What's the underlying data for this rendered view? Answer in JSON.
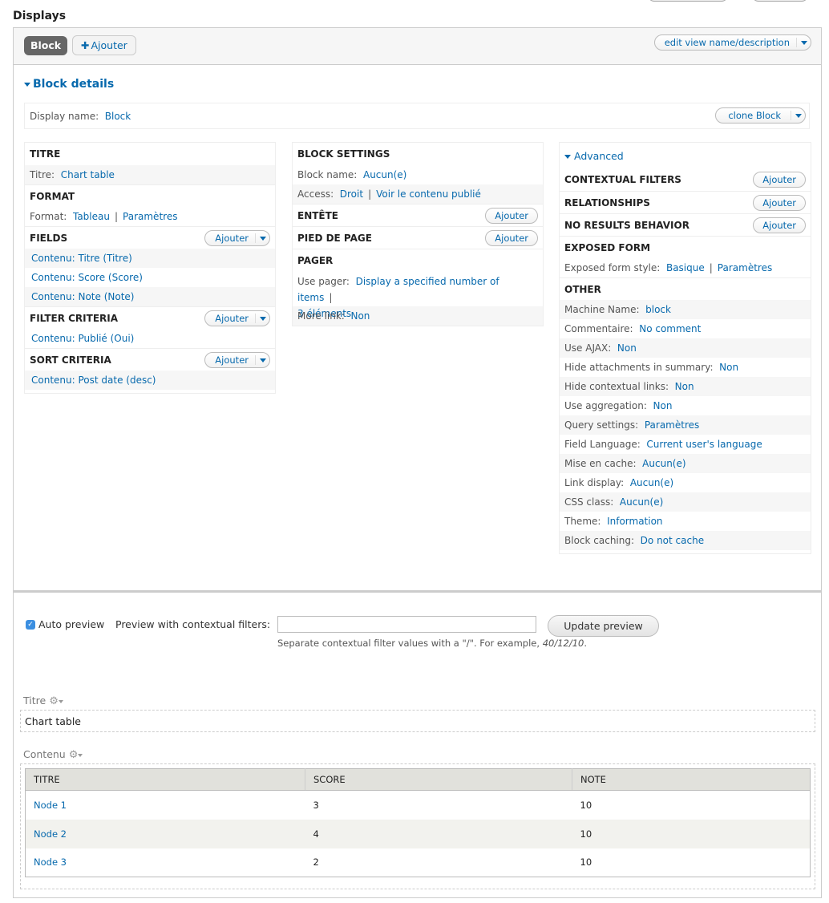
{
  "page_title": "Displays",
  "tabs": {
    "active": "Block",
    "add_label": "Ajouter",
    "add_icon": "plus-icon"
  },
  "edit_view_button": "edit view name/description",
  "block_details": {
    "toggle_label": "Block details",
    "display_name_label": "Display name:",
    "display_name_value": "Block",
    "clone_button": "clone Block"
  },
  "add_label": "Ajouter",
  "col1": {
    "titre": {
      "heading": "TITRE",
      "label": "Titre:",
      "value": "Chart table"
    },
    "format": {
      "heading": "FORMAT",
      "label": "Format:",
      "value": "Tableau",
      "settings": "Paramètres"
    },
    "fields": {
      "heading": "FIELDS",
      "items": [
        "Contenu: Titre (Titre)",
        "Contenu: Score (Score)",
        "Contenu: Note (Note)"
      ]
    },
    "filter": {
      "heading": "FILTER CRITERIA",
      "items": [
        "Contenu: Publié (Oui)"
      ]
    },
    "sort": {
      "heading": "SORT CRITERIA",
      "items": [
        "Contenu: Post date (desc)"
      ]
    }
  },
  "col2": {
    "block_settings": {
      "heading": "BLOCK SETTINGS",
      "name_label": "Block name:",
      "name_value": "Aucun(e)",
      "access_label": "Access:",
      "access_value": "Droit",
      "access_perm": "Voir le contenu publié"
    },
    "header": {
      "heading": "ENTÊTE"
    },
    "footer": {
      "heading": "PIED DE PAGE"
    },
    "pager": {
      "heading": "PAGER",
      "label": "Use pager:",
      "value": "Display a specified number of items",
      "count": "3 éléments",
      "more_label": "More link:",
      "more_value": "Non"
    }
  },
  "col3": {
    "advanced_toggle": "Advanced",
    "contextual": {
      "heading": "CONTEXTUAL FILTERS"
    },
    "relationships": {
      "heading": "RELATIONSHIPS"
    },
    "no_results": {
      "heading": "NO RESULTS BEHAVIOR"
    },
    "exposed": {
      "heading": "EXPOSED FORM",
      "label": "Exposed form style:",
      "value": "Basique",
      "settings": "Paramètres"
    },
    "other": {
      "heading": "OTHER",
      "rows": [
        {
          "label": "Machine Name:",
          "value": "block"
        },
        {
          "label": "Commentaire:",
          "value": "No comment"
        },
        {
          "label": "Use AJAX:",
          "value": "Non"
        },
        {
          "label": "Hide attachments in summary:",
          "value": "Non"
        },
        {
          "label": "Hide contextual links:",
          "value": "Non"
        },
        {
          "label": "Use aggregation:",
          "value": "Non"
        },
        {
          "label": "Query settings:",
          "value": "Paramètres"
        },
        {
          "label": "Field Language:",
          "value": "Current user's language"
        },
        {
          "label": "Mise en cache:",
          "value": "Aucun(e)"
        },
        {
          "label": "Link display:",
          "value": "Aucun(e)"
        },
        {
          "label": "CSS class:",
          "value": "Aucun(e)"
        },
        {
          "label": "Theme:",
          "value": "Information"
        },
        {
          "label": "Block caching:",
          "value": "Do not cache"
        }
      ]
    }
  },
  "preview": {
    "auto_preview_label": "Auto preview",
    "auto_preview_checked": true,
    "contextual_label": "Preview with contextual filters:",
    "contextual_value": "",
    "description_prefix": "Separate contextual filter values with a \"/\". For example, ",
    "description_example": "40/12/10",
    "description_suffix": ".",
    "update_button": "Update preview"
  },
  "result": {
    "title_area_label": "Titre",
    "title_value": "Chart table",
    "content_area_label": "Contenu",
    "columns": [
      "TITRE",
      "SCORE",
      "NOTE"
    ],
    "rows": [
      [
        "Node 1",
        "3",
        "10"
      ],
      [
        "Node 2",
        "4",
        "10"
      ],
      [
        "Node 3",
        "2",
        "10"
      ]
    ]
  }
}
